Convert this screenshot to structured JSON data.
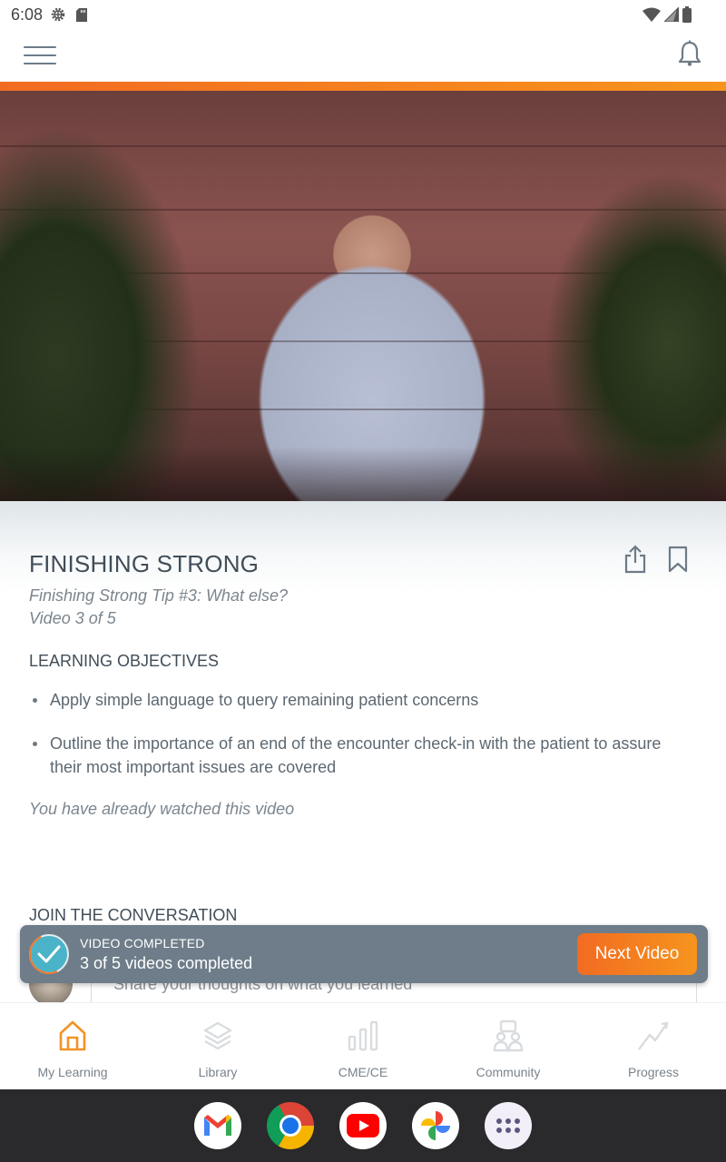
{
  "status_bar": {
    "time": "6:08"
  },
  "colors": {
    "accent": "#f47c20",
    "accent_start": "#f26b22",
    "accent_end": "#f7941d",
    "toast_bg": "#6e7d89",
    "check_teal": "#4bb3c8",
    "text_dark": "#414d58"
  },
  "course": {
    "title": "FINISHING STRONG",
    "video_title": "Finishing Strong Tip #3: What else?",
    "video_position": "Video 3 of 5"
  },
  "objectives": {
    "heading": "LEARNING OBJECTIVES",
    "items": [
      "Apply simple language to query remaining patient concerns",
      "Outline the importance of an end of the encounter check-in with the patient to assure their most important issues are covered"
    ]
  },
  "watched_note": "You have already watched this video",
  "conversation": {
    "heading": "JOIN THE CONVERSATION",
    "placeholder": "Share your thoughts on what you learned"
  },
  "toast": {
    "title": "VIDEO COMPLETED",
    "subtitle": "3 of 5 videos completed",
    "completed": 3,
    "total": 5,
    "button_label": "Next Video"
  },
  "bottom_nav": {
    "active": "My Learning",
    "items": [
      {
        "label": "My Learning",
        "icon": "home-icon"
      },
      {
        "label": "Library",
        "icon": "layers-icon"
      },
      {
        "label": "CME/CE",
        "icon": "bar-chart-icon"
      },
      {
        "label": "Community",
        "icon": "community-icon"
      },
      {
        "label": "Progress",
        "icon": "trend-icon"
      }
    ]
  },
  "dock": {
    "apps": [
      "Gmail",
      "Chrome",
      "YouTube",
      "Photos",
      "App drawer"
    ]
  }
}
